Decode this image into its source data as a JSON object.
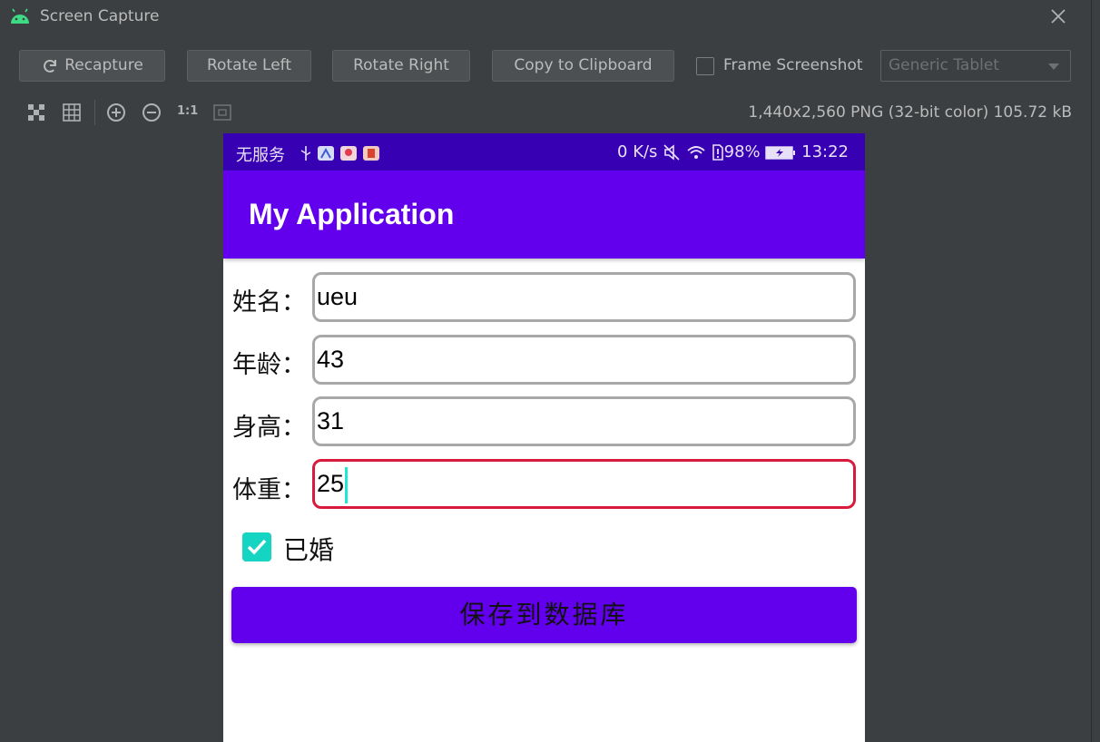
{
  "window": {
    "title": "Screen Capture",
    "app_icon": "android-icon",
    "close_icon": "close-icon"
  },
  "toolbar": {
    "recapture_label": "Recapture",
    "recapture_icon": "refresh-icon",
    "rotate_left_label": "Rotate Left",
    "rotate_right_label": "Rotate Right",
    "copy_label": "Copy to Clipboard",
    "frame_screenshot_label": "Frame Screenshot",
    "frame_screenshot_checked": false,
    "device_frame_value": "Generic Tablet"
  },
  "view_tools": {
    "icons": [
      "transparency-grid-icon",
      "grid-icon",
      "zoom-in-icon",
      "zoom-out-icon",
      "fit-icon"
    ],
    "actual_size_label": "1:1",
    "image_info": "1,440x2,560 PNG (32-bit color) 105.72 kB"
  },
  "phone": {
    "status_bar": {
      "carrier": "无服务",
      "speed": "0 K/s",
      "battery": "98%",
      "time": "13:22",
      "icons": [
        "usb-icon",
        "app-notification-icon",
        "map-notification-icon",
        "book-notification-icon",
        "mute-icon",
        "wifi-icon",
        "sim-icon",
        "battery-icon"
      ]
    },
    "app_bar": {
      "title": "My Application"
    },
    "form": {
      "name_label": "姓名：",
      "name_value": "ueu",
      "age_label": "年龄：",
      "age_value": "43",
      "height_label": "身高：",
      "height_value": "31",
      "weight_label": "体重：",
      "weight_value": "25",
      "married_label": "已婚",
      "married_checked": true,
      "save_label": "保存到数据库"
    },
    "colors": {
      "status_bar": "#3700b3",
      "primary": "#6200ee",
      "accent": "#16d4c2",
      "focus_border": "#d81b3c"
    }
  }
}
